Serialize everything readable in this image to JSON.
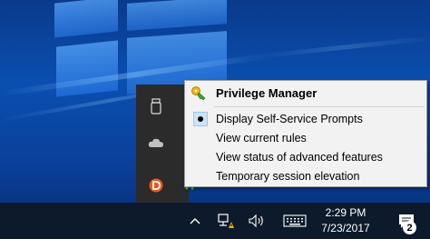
{
  "menu": {
    "title": "Privilege Manager",
    "title_icon": "privilege-manager-key-icon",
    "items": [
      {
        "label": "Display Self-Service Prompts",
        "selected": true
      },
      {
        "label": "View current rules",
        "selected": false
      },
      {
        "label": "View status of advanced features",
        "selected": false
      },
      {
        "label": "Temporary session elevation",
        "selected": false
      }
    ]
  },
  "tray_overflow": {
    "icons": [
      "usb-drive-icon",
      "onedrive-cloud-icon",
      "dashlane-icon"
    ]
  },
  "taskbar": {
    "time": "2:29 PM",
    "date": "7/23/2017",
    "notification_count": "2",
    "icons": [
      "show-hidden-icons-chevron",
      "network-warning-icon",
      "volume-icon",
      "touch-keyboard-icon",
      "action-center-icon"
    ]
  },
  "colors": {
    "accent_orange": "#e8581c",
    "menu_bg": "#f2f2f2",
    "taskbar_bg": "#0d1a2b"
  }
}
